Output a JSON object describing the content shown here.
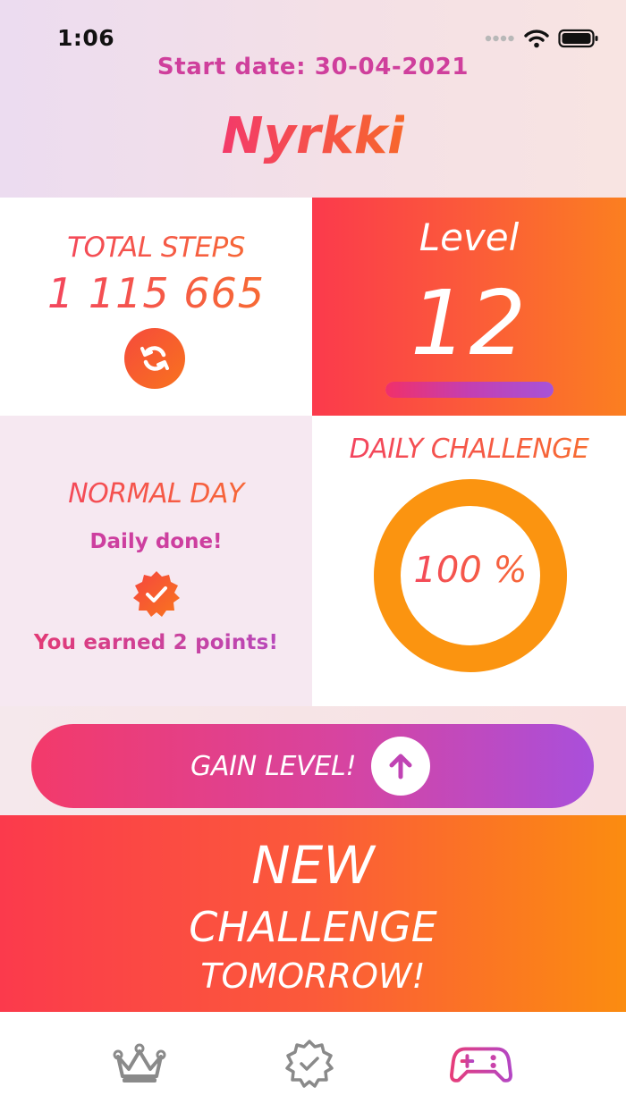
{
  "status_bar": {
    "time": "1:06"
  },
  "header": {
    "start_date": "Start date:  30-04-2021",
    "title": "Nyrkki"
  },
  "steps": {
    "title": "TOTAL STEPS",
    "value": "1 115 665",
    "refresh_icon": "refresh-icon"
  },
  "level": {
    "label": "Level",
    "value": "12",
    "progress": 1.0
  },
  "normal_day": {
    "title": "NORMAL DAY",
    "status": "Daily done!",
    "badge_icon": "check-badge-icon",
    "points_text": "You earned 2 points!"
  },
  "daily_challenge": {
    "title": "DAILY CHALLENGE",
    "percent_label": "100 %",
    "progress": 1.0
  },
  "gain_level": {
    "label": "GAIN LEVEL!",
    "icon": "arrow-up-icon"
  },
  "new_challenge": {
    "line1": "NEW",
    "line2": "CHALLENGE",
    "line3": "TOMORROW!"
  },
  "tabs": [
    {
      "name": "leaderboard",
      "icon": "crown-icon",
      "active": false
    },
    {
      "name": "achievements",
      "icon": "check-badge-icon",
      "active": false
    },
    {
      "name": "challenges",
      "icon": "gamepad-icon",
      "active": true
    }
  ],
  "colors": {
    "accent_red": "#fb3a4c",
    "accent_orange": "#fb8c10",
    "accent_pink": "#cf3f9c",
    "accent_purple": "#a94fdb",
    "ring_orange": "#fb9410",
    "tab_inactive": "#8a8a8a"
  }
}
